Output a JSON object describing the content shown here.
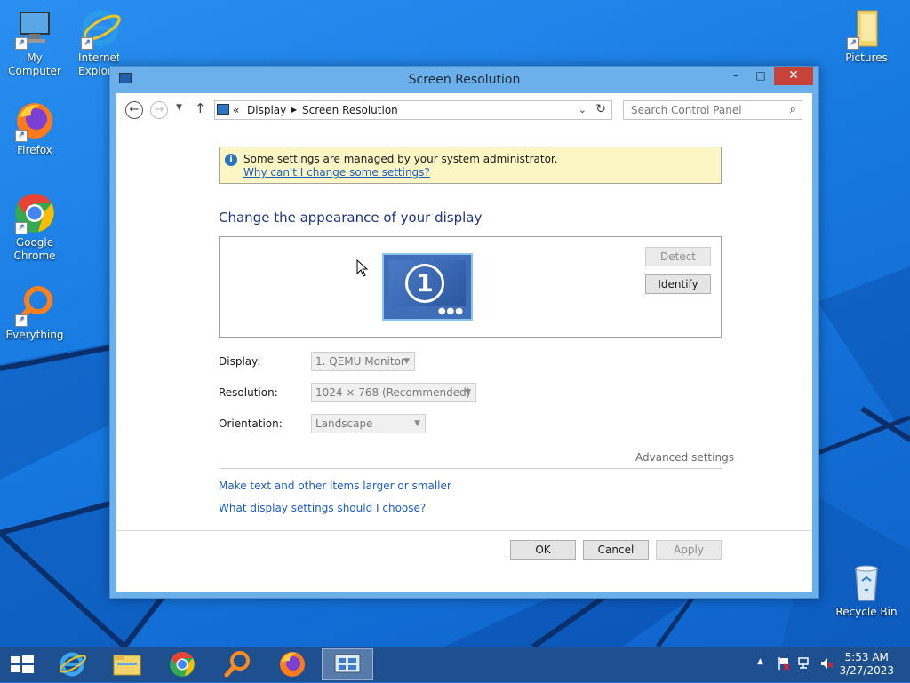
{
  "desktop": {
    "icons": [
      {
        "label": "My Computer"
      },
      {
        "label": "Internet Explorer"
      },
      {
        "label": "Firefox"
      },
      {
        "label": "Google Chrome"
      },
      {
        "label": "Everything"
      },
      {
        "label": "Pictures"
      },
      {
        "label": "Recycle Bin"
      }
    ]
  },
  "window": {
    "title": "Screen Resolution",
    "controls": {
      "minimize": "–",
      "maximize": "□",
      "close": "✕"
    },
    "address": {
      "prefix": "«",
      "crumbs": [
        "Display",
        "Screen Resolution"
      ]
    },
    "search_placeholder": "Search Control Panel",
    "info": {
      "text": "Some settings are managed by your system administrator.",
      "link": "Why can't I change some settings?"
    },
    "heading": "Change the appearance of your display",
    "monitor_number": "1",
    "detect_label": "Detect",
    "identify_label": "Identify",
    "fields": {
      "display": {
        "label": "Display:",
        "value": "1. QEMU Monitor"
      },
      "resolution": {
        "label": "Resolution:",
        "value": "1024 × 768 (Recommended)"
      },
      "orientation": {
        "label": "Orientation:",
        "value": "Landscape"
      }
    },
    "advanced_settings": "Advanced settings",
    "links": [
      "Make text and other items larger or smaller",
      "What display settings should I choose?"
    ],
    "buttons": {
      "ok": "OK",
      "cancel": "Cancel",
      "apply": "Apply"
    }
  },
  "taskbar": {
    "time": "5:53 AM",
    "date": "3/27/2023"
  },
  "colors": {
    "accent": "#1a5ec4",
    "heading": "#1e3287",
    "close": "#c7433a",
    "info_bg": "#fcf6c4"
  }
}
